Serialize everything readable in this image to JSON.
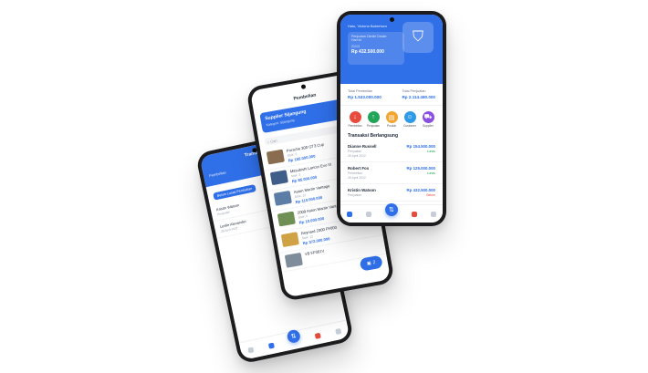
{
  "phone_left": {
    "title": "Transaksi",
    "tab_label": "Pembelian",
    "chip_label": "Belum Lunas Pembelian",
    "items": [
      {
        "name": "Kristin Watson",
        "sub": "Penjualan",
        "amount": "Rp 432.5"
      },
      {
        "name": "Leslie Alexander",
        "sub": "26 April 2022",
        "amount": "Rp 125.0"
      }
    ],
    "fab_icon": "swap-icon"
  },
  "phone_middle": {
    "title": "Pembelian",
    "banner_title": "Supplier Sijangung",
    "banner_subtitle": "Kategori: Sijangung",
    "search_placeholder": "Cari",
    "cars": [
      {
        "name": "Porsche 300 GT3 Cup",
        "stock": "Stok: 5",
        "price": "Rp 155.000.000",
        "color": "#8a6d4f"
      },
      {
        "name": "Mitsubishi Lancer Evo IX",
        "stock": "Stok: 3",
        "price": "Rp 85.000.000",
        "color": "#3f5f8a"
      },
      {
        "name": "Aston Martin Vantage",
        "stock": "Stok: 12",
        "price": "Rp 110.000.000",
        "color": "#5b7da6"
      },
      {
        "name": "2009 Aston Martin Vantage",
        "stock": "Stok: 5",
        "price": "Rp 10.000.000",
        "color": "#6f8f54"
      },
      {
        "name": "Reynard 2300 FF000",
        "stock": "Stok: 12",
        "price": "Rp 372.000.000",
        "color": "#d0a246"
      },
      {
        "name": "VB FF001V",
        "stock": "",
        "price": "",
        "color": "#7f8c9a"
      }
    ],
    "cart_count": "2"
  },
  "phone_right": {
    "greeting": "Halo, Victoria Babertsen",
    "card_label": "Penjualan Dimitri Dealer",
    "card_sub": "Hari ini",
    "card_date": "21/13",
    "card_amount": "Rp 432.500.000",
    "total_pembelian_label": "Total Pembelian",
    "total_pembelian": "Rp 1.533.000.000",
    "total_penjualan_label": "Total Penjualan",
    "total_penjualan": "Rp 2.114.480.000",
    "actions": [
      {
        "label": "Pembelian",
        "icon": "arrow-down-icon",
        "color": "#e64b3c"
      },
      {
        "label": "Penjualan",
        "icon": "arrow-up-icon",
        "color": "#22a559"
      },
      {
        "label": "Produk",
        "icon": "box-icon",
        "color": "#f2a531"
      },
      {
        "label": "Customer",
        "icon": "user-icon",
        "color": "#2f9be8"
      },
      {
        "label": "Supplier",
        "icon": "truck-icon",
        "color": "#8a4fe0"
      }
    ],
    "section_title": "Transaksi Berlangsung",
    "transactions": [
      {
        "name": "Dianne Russell",
        "sub": "Penjualan",
        "date": "26 April 2022",
        "amount": "Rp 154.500.000",
        "status": "Lunas",
        "status_class": "green"
      },
      {
        "name": "Robert Fox",
        "sub": "Pembelian",
        "date": "26 April 2022",
        "amount": "Rp 125.000.000",
        "status": "Lunas",
        "status_class": "green"
      },
      {
        "name": "Kristin Watson",
        "sub": "Penjualan",
        "date": "",
        "amount": "Rp 432.500.000",
        "status": "Belum",
        "status_class": "red"
      }
    ]
  },
  "colors": {
    "primary": "#2f6fe8",
    "green": "#22a559",
    "red": "#e64b3c"
  }
}
